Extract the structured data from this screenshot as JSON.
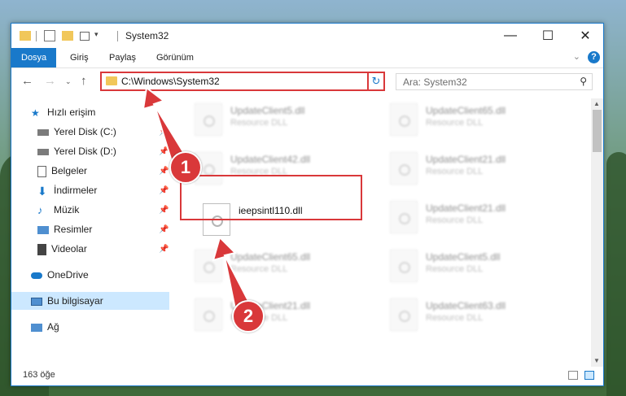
{
  "window": {
    "title": "System32",
    "controls": {
      "minimize": "—",
      "maximize": "☐",
      "close": "✕"
    }
  },
  "ribbon": {
    "tabs": [
      {
        "label": "Dosya",
        "active": true
      },
      {
        "label": "Giriş"
      },
      {
        "label": "Paylaş"
      },
      {
        "label": "Görünüm"
      }
    ],
    "help": "?"
  },
  "navigation": {
    "address": "C:\\Windows\\System32",
    "search_placeholder": "Ara: System32"
  },
  "sidebar": {
    "quick_access": "Hızlı erişim",
    "items": [
      {
        "label": "Yerel Disk (C:)",
        "icon": "drive-icon"
      },
      {
        "label": "Yerel Disk (D:)",
        "icon": "drive-icon"
      },
      {
        "label": "Belgeler",
        "icon": "documents-icon"
      },
      {
        "label": "İndirmeler",
        "icon": "download-icon"
      },
      {
        "label": "Müzik",
        "icon": "music-icon"
      },
      {
        "label": "Resimler",
        "icon": "pictures-icon"
      },
      {
        "label": "Videolar",
        "icon": "videos-icon"
      }
    ],
    "onedrive": "OneDrive",
    "this_pc": "Bu bilgisayar",
    "network": "Ağ"
  },
  "files": {
    "col1": [
      "UpdateClient5.dll",
      "UpdateClient42.dll",
      "ieepsintl110.dll",
      "UpdateClient65.dll",
      "UpdateClient21.dll"
    ],
    "col2": [
      "UpdateClient65.dll",
      "UpdateClient21.dll",
      "UpdateClient21.dll",
      "UpdateClient5.dll",
      "UpdateClient63.dll"
    ],
    "type": "Resource DLL"
  },
  "status": {
    "count": "163 öğe"
  },
  "annotations": {
    "step1": "1",
    "step2": "2"
  },
  "colors": {
    "accent": "#1979ca",
    "highlight": "#d9383a",
    "selected": "#cce8ff"
  }
}
